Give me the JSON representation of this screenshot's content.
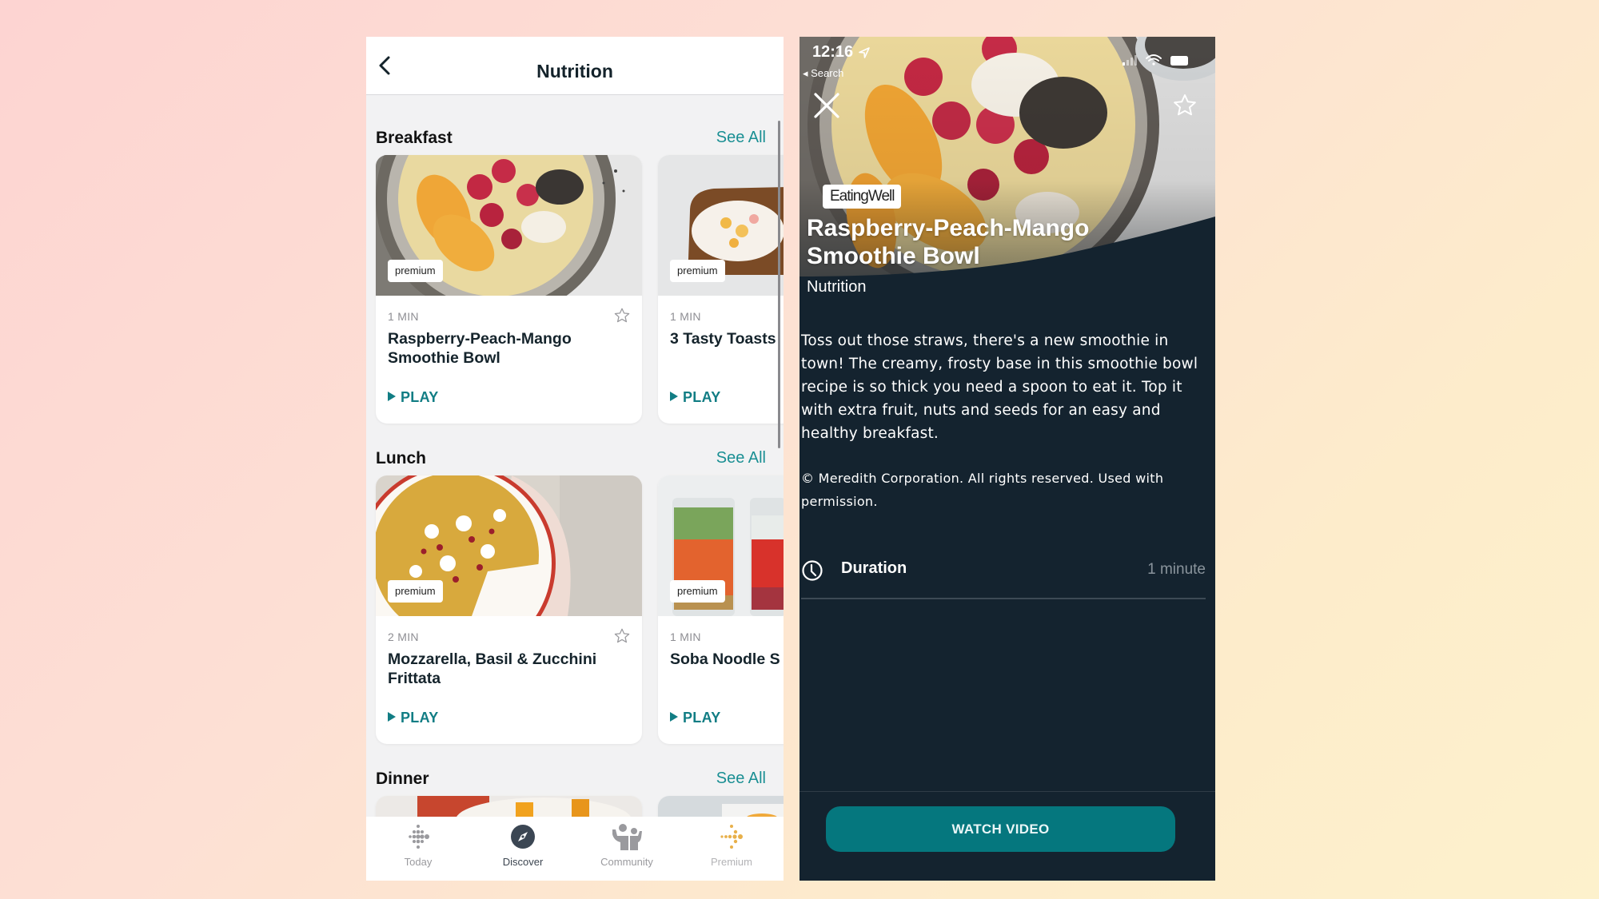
{
  "left_screen": {
    "header": {
      "title": "Nutrition",
      "back_icon": "chevron-left-icon"
    },
    "sections": [
      {
        "title": "Breakfast",
        "see_all_label": "See All",
        "cards": [
          {
            "badge": "premium",
            "duration": "1 MIN",
            "title": "Raspberry-Peach-Mango Smoothie Bowl",
            "play_label": "PLAY",
            "favorite_icon": "star-outline-icon"
          },
          {
            "badge": "premium",
            "duration": "1 MIN",
            "title": "3 Tasty Toasts",
            "play_label": "PLAY"
          }
        ]
      },
      {
        "title": "Lunch",
        "see_all_label": "See All",
        "cards": [
          {
            "badge": "premium",
            "duration": "2 MIN",
            "title": "Mozzarella, Basil & Zucchini Frittata",
            "play_label": "PLAY",
            "favorite_icon": "star-outline-icon"
          },
          {
            "badge": "premium",
            "duration": "1 MIN",
            "title": "Soba Noodle S",
            "play_label": "PLAY"
          }
        ]
      },
      {
        "title": "Dinner",
        "see_all_label": "See All",
        "cards": []
      }
    ],
    "tab_bar": {
      "items": [
        {
          "label": "Today",
          "icon": "fitbit-dots-icon",
          "active": false
        },
        {
          "label": "Discover",
          "icon": "compass-icon",
          "active": true
        },
        {
          "label": "Community",
          "icon": "people-icon",
          "active": false
        },
        {
          "label": "Premium",
          "icon": "premium-dots-icon",
          "active": false
        }
      ]
    }
  },
  "right_screen": {
    "status_bar": {
      "time": "12:16",
      "back_label": "◂ Search"
    },
    "hero": {
      "source_badge": "EatingWell",
      "title": "Raspberry-Peach-Mango Smoothie Bowl",
      "category": "Nutrition"
    },
    "description": "Toss out those straws, there's a new smoothie in town! The creamy, frosty base in this smoothie bowl recipe is so thick you need a spoon to eat it. Top it with extra fruit, nuts and seeds for an easy and healthy breakfast.",
    "copyright": "© Meredith Corporation. All rights reserved. Used with permission.",
    "duration": {
      "label": "Duration",
      "value": "1 minute"
    },
    "watch_button_label": "WATCH VIDEO"
  },
  "colors": {
    "accent_teal": "#1a8f93",
    "play_teal": "#117d84",
    "button_teal": "#05777e",
    "dark_bg": "#14232f",
    "premium_gold": "#e8b04a"
  }
}
